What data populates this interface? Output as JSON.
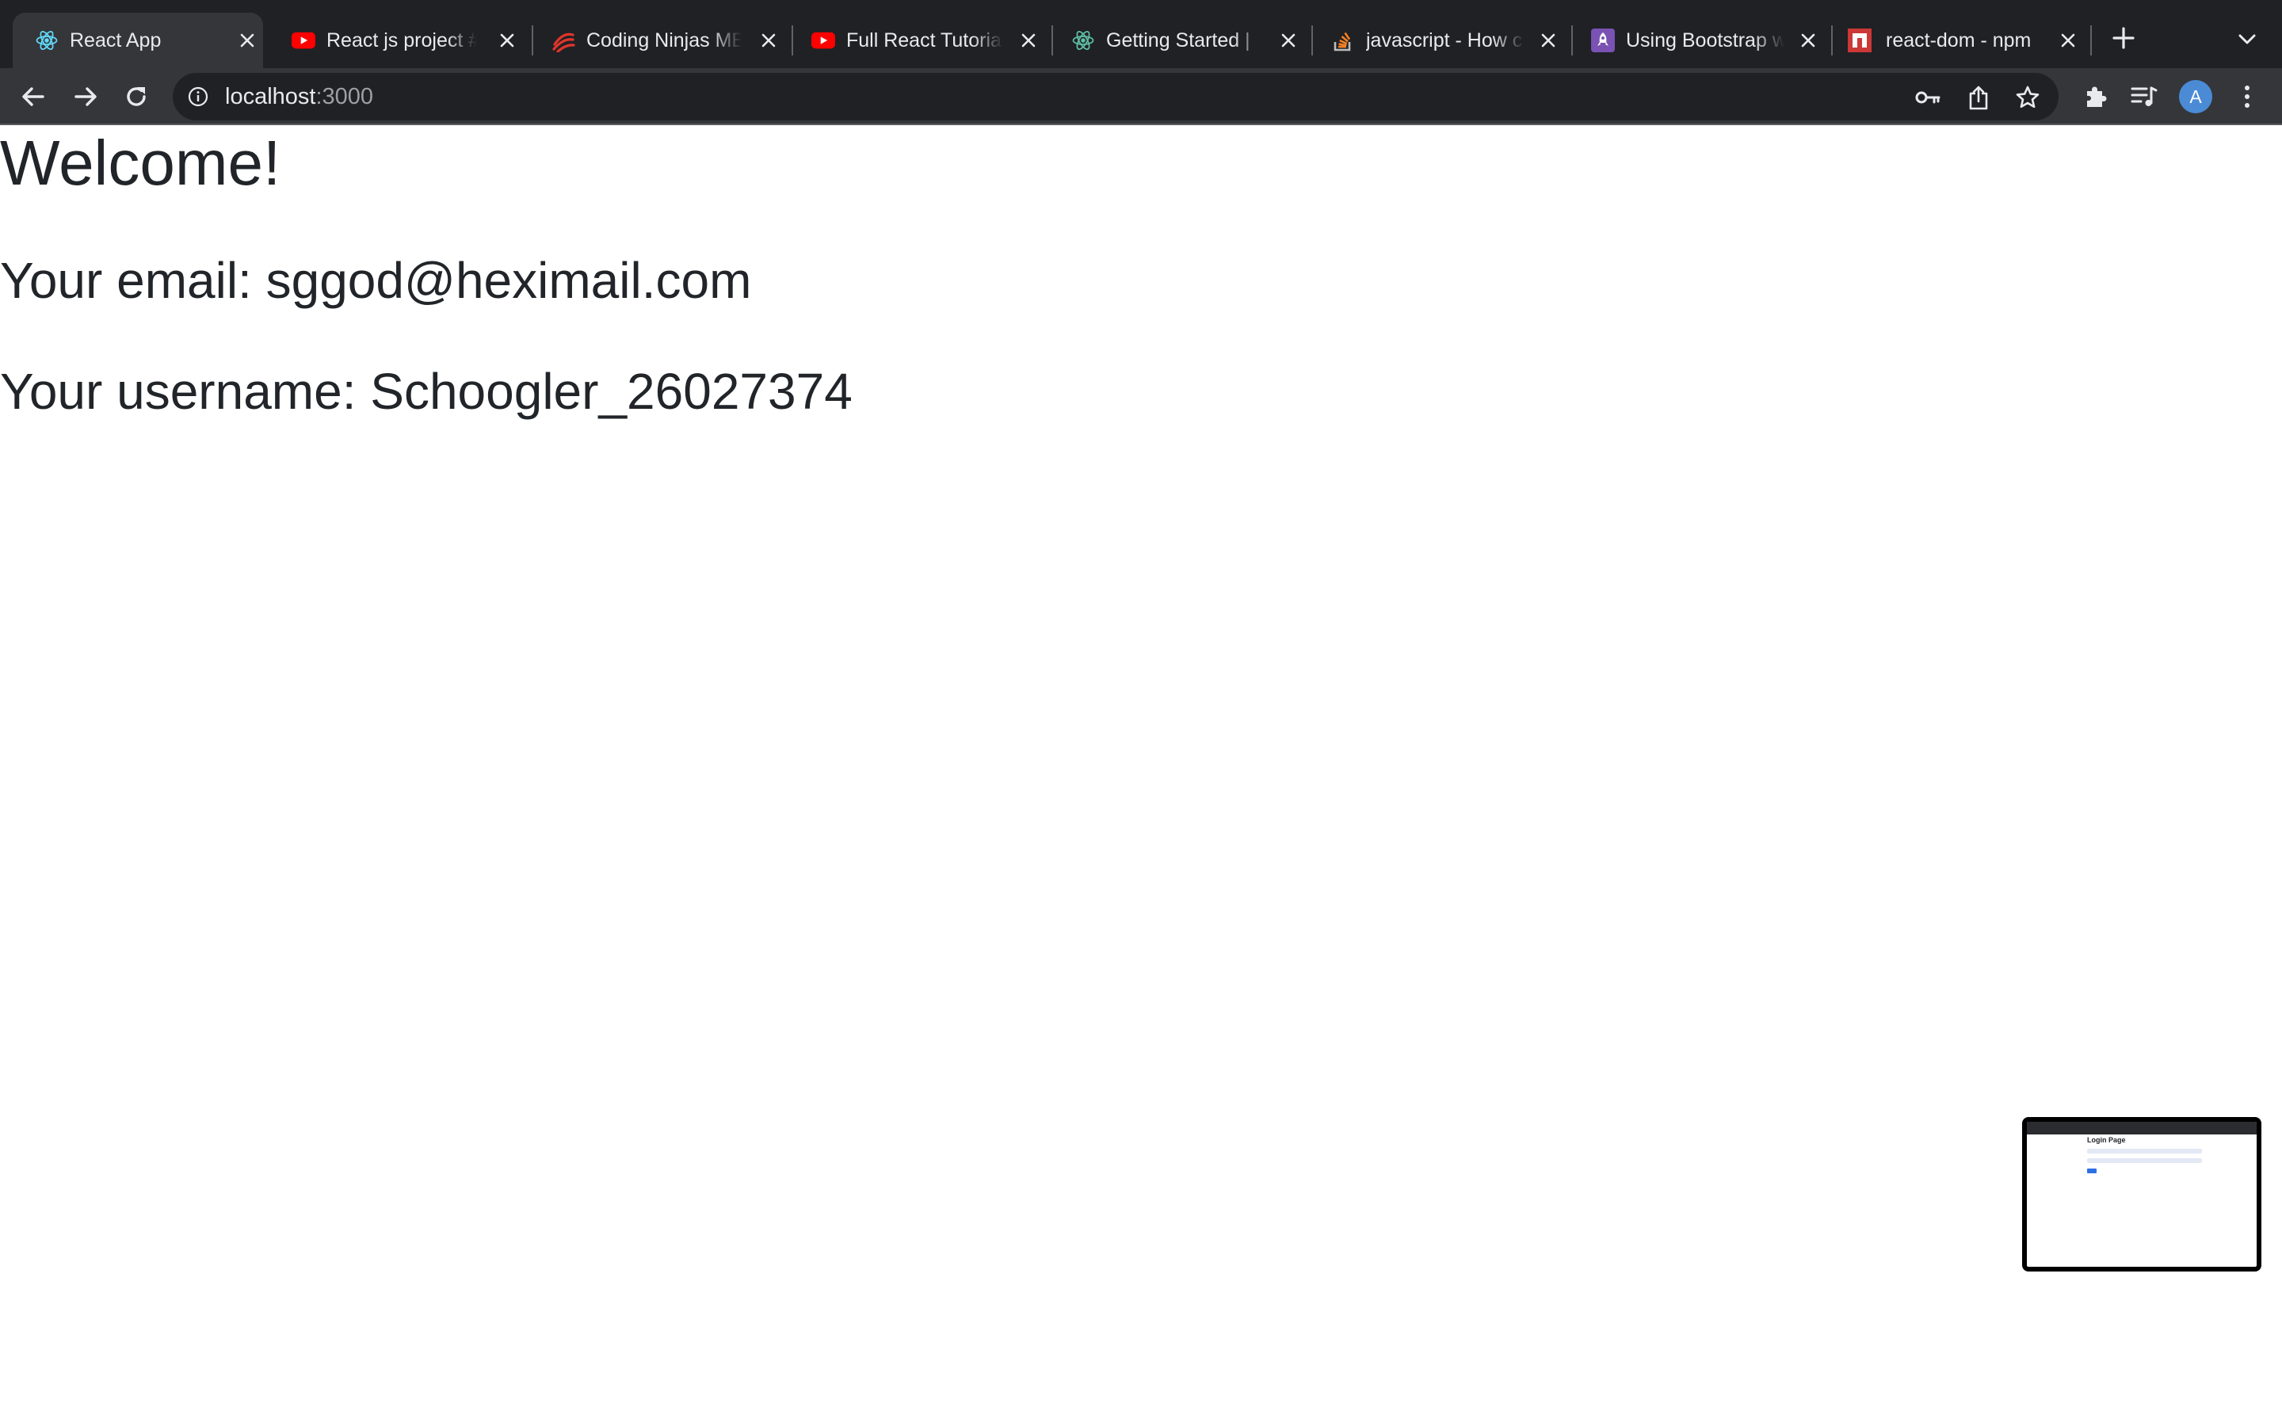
{
  "tabs": [
    {
      "title": "React App",
      "favicon": "react-icon",
      "active": true
    },
    {
      "title": "React js project #",
      "favicon": "youtube-icon"
    },
    {
      "title": "Coding Ninjas ME",
      "favicon": "coding-ninjas-icon"
    },
    {
      "title": "Full React Tutorial",
      "favicon": "youtube-icon"
    },
    {
      "title": "Getting Started | ",
      "favicon": "react-icon"
    },
    {
      "title": "javascript - How c",
      "favicon": "stackoverflow-icon"
    },
    {
      "title": "Using Bootstrap w",
      "favicon": "bootstrap-icon"
    },
    {
      "title": "react-dom - npm",
      "favicon": "npm-icon"
    }
  ],
  "toolbar": {
    "url_host": "localhost",
    "url_port": ":3000",
    "avatar_initial": "A"
  },
  "page": {
    "heading": "Welcome!",
    "email_line": "Your email: sggod@heximail.com",
    "username_line": "Your username: Schoogler_26027374"
  },
  "thumbnail": {
    "title": "Login Page"
  },
  "colors": {
    "tabstrip_bg": "#202124",
    "toolbar_bg": "#35363a",
    "page_text": "#212529",
    "youtube_red": "#ff0000",
    "react_cyan": "#61dafb",
    "npm_red": "#cb3837",
    "bootstrap_purple": "#7952b3",
    "avatar_blue": "#4b8bd6"
  }
}
